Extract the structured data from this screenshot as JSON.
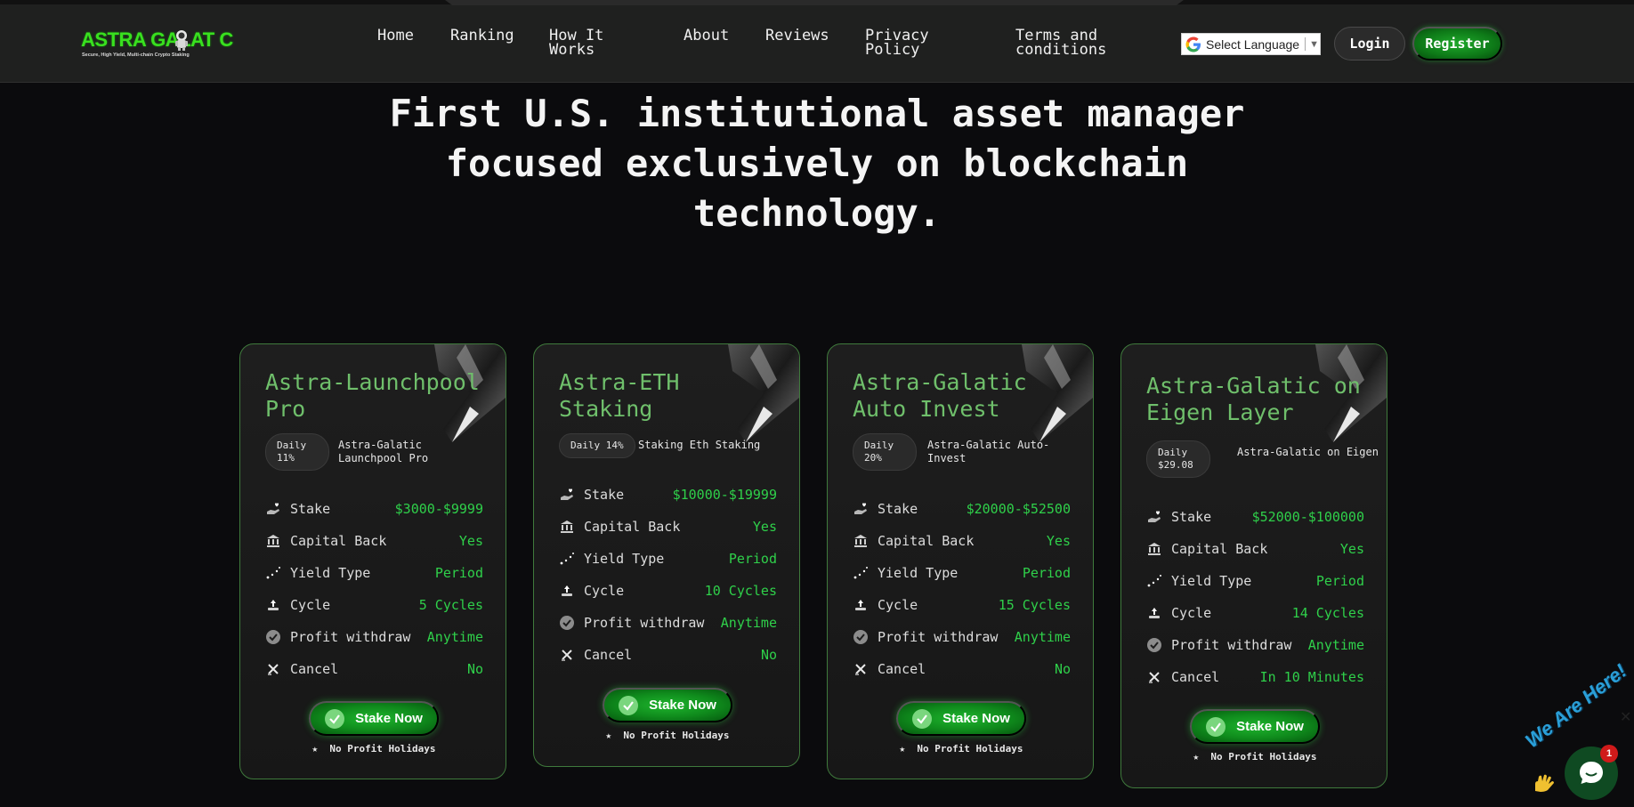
{
  "header": {
    "logo_text": "ASTRA GALAT C",
    "logo_tagline": "Secure, High Yield, Multi-chain Crypto Staking",
    "nav": [
      {
        "label": "Home",
        "key": "home"
      },
      {
        "label": "Ranking",
        "key": "ranking"
      },
      {
        "label": "How It\nWorks",
        "key": "how"
      },
      {
        "label": "About",
        "key": "about"
      },
      {
        "label": "Reviews",
        "key": "reviews"
      },
      {
        "label": "Privacy\nPolicy",
        "key": "privacy"
      },
      {
        "label": "Terms and\nconditions",
        "key": "terms"
      }
    ],
    "language_label": "Select Language",
    "login_label": "Login",
    "register_label": "Register"
  },
  "hero": {
    "line1": "First U.S. institutional asset manager",
    "line2": "focused exclusively on blockchain",
    "line3": "technology."
  },
  "cards": [
    {
      "title": "Astra-Launchpool Pro",
      "rate": "Daily 11%",
      "desc": "Astra-Galatic Launchpool Pro",
      "rows": [
        {
          "icon": "stake-hand-heart-icon",
          "label": "Stake",
          "value": "$3000-$9999"
        },
        {
          "icon": "bank-icon",
          "label": "Capital Back",
          "value": "Yes"
        },
        {
          "icon": "yield-dots-icon",
          "label": "Yield Type",
          "value": "Period"
        },
        {
          "icon": "cycle-icon",
          "label": "Cycle",
          "value": "5 Cycles"
        },
        {
          "icon": "check-circle-icon",
          "label": "Profit withdraw",
          "value": "Anytime"
        },
        {
          "icon": "cancel-icon",
          "label": "Cancel",
          "value": "No"
        }
      ],
      "button": "Stake Now",
      "note": "No Profit Holidays"
    },
    {
      "title": "Astra-ETH Staking",
      "rate": "Daily 14%",
      "desc": "Staking Eth Staking",
      "rows": [
        {
          "icon": "stake-hand-heart-icon",
          "label": "Stake",
          "value": "$10000-$19999"
        },
        {
          "icon": "bank-icon",
          "label": "Capital Back",
          "value": "Yes"
        },
        {
          "icon": "yield-dots-icon",
          "label": "Yield Type",
          "value": "Period"
        },
        {
          "icon": "cycle-icon",
          "label": "Cycle",
          "value": "10 Cycles"
        },
        {
          "icon": "check-circle-icon",
          "label": "Profit withdraw",
          "value": "Anytime"
        },
        {
          "icon": "cancel-icon",
          "label": "Cancel",
          "value": "No"
        }
      ],
      "button": "Stake Now",
      "note": "No Profit Holidays"
    },
    {
      "title": "Astra-Galatic Auto Invest",
      "rate": "Daily 20%",
      "desc": "Astra-Galatic Auto-Invest",
      "rows": [
        {
          "icon": "stake-hand-heart-icon",
          "label": "Stake",
          "value": "$20000-$52500"
        },
        {
          "icon": "bank-icon",
          "label": "Capital Back",
          "value": "Yes"
        },
        {
          "icon": "yield-dots-icon",
          "label": "Yield Type",
          "value": "Period"
        },
        {
          "icon": "cycle-icon",
          "label": "Cycle",
          "value": "15 Cycles"
        },
        {
          "icon": "check-circle-icon",
          "label": "Profit withdraw",
          "value": "Anytime"
        },
        {
          "icon": "cancel-icon",
          "label": "Cancel",
          "value": "No"
        }
      ],
      "button": "Stake Now",
      "note": "No Profit Holidays"
    },
    {
      "title": "Astra-Galatic on Eigen Layer",
      "rate": "Daily $29.08",
      "desc": "Astra-Galatic on Eigen",
      "rows": [
        {
          "icon": "stake-hand-heart-icon",
          "label": "Stake",
          "value": "$52000-$100000"
        },
        {
          "icon": "bank-icon",
          "label": "Capital Back",
          "value": "Yes"
        },
        {
          "icon": "yield-dots-icon",
          "label": "Yield Type",
          "value": "Period"
        },
        {
          "icon": "cycle-icon",
          "label": "Cycle",
          "value": "14 Cycles"
        },
        {
          "icon": "check-circle-icon",
          "label": "Profit withdraw",
          "value": "Anytime"
        },
        {
          "icon": "cancel-icon",
          "label": "Cancel",
          "value": "In 10 Minutes"
        }
      ],
      "button": "Stake Now",
      "note": "No Profit Holidays"
    }
  ],
  "chat": {
    "banner": "We Are Here!",
    "badge": "1"
  },
  "colors": {
    "accent_green": "#2fd04a",
    "title_green": "#6fbf6b",
    "background": "#0b0b0d"
  }
}
